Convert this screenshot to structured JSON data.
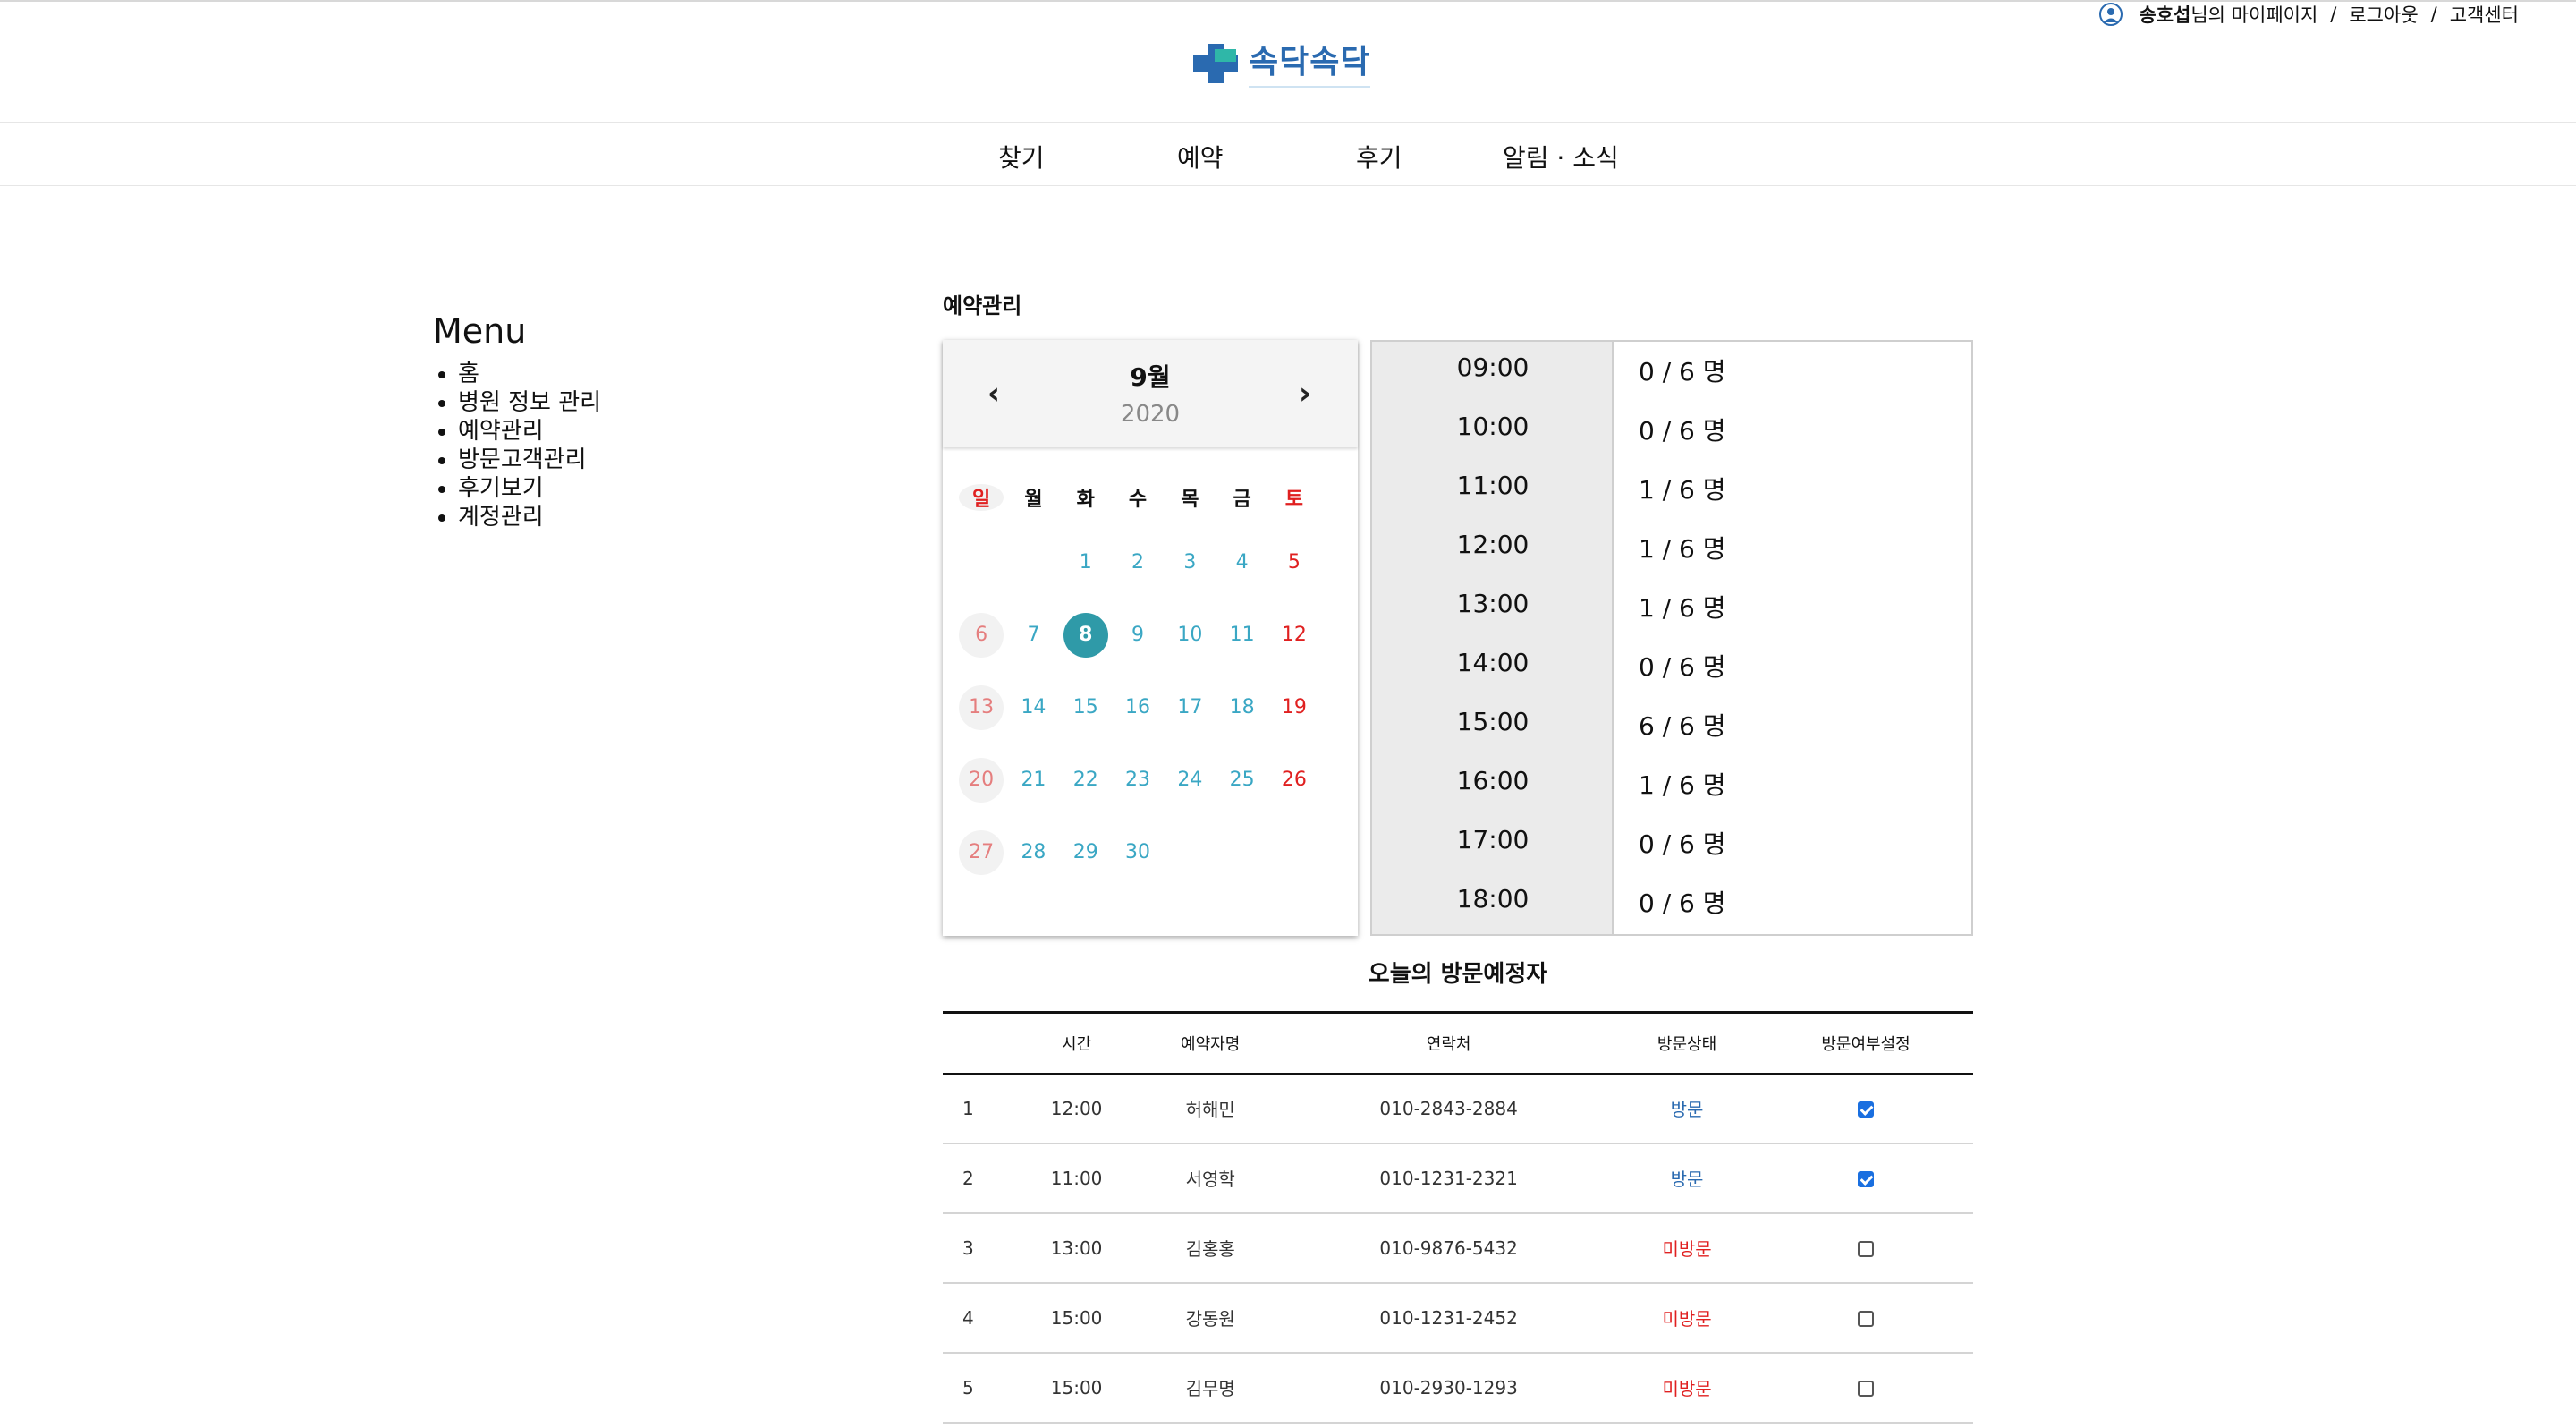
{
  "user_bar": {
    "user_name": "송호섭",
    "mypage_suffix": "님의 마이페이지",
    "sep1": "/",
    "logout": "로그아웃",
    "sep2": "/",
    "support": "고객센터"
  },
  "logo": {
    "text": "속닥속닥"
  },
  "nav": {
    "items": [
      "찾기",
      "예약",
      "후기",
      "알림 · 소식"
    ]
  },
  "sidebar": {
    "title": "Menu",
    "items": [
      "홈",
      "병원 정보 관리",
      "예약관리",
      "방문고객관리",
      "후기보기",
      "계정관리"
    ]
  },
  "main": {
    "title": "예약관리"
  },
  "calendar": {
    "month": "9월",
    "year": "2020",
    "prev_icon": "‹",
    "next_icon": "›",
    "weekdays": [
      "일",
      "월",
      "화",
      "수",
      "목",
      "금",
      "토"
    ],
    "weeks": [
      [
        "",
        "",
        "1",
        "2",
        "3",
        "4",
        "5"
      ],
      [
        "6",
        "7",
        "8",
        "9",
        "10",
        "11",
        "12"
      ],
      [
        "13",
        "14",
        "15",
        "16",
        "17",
        "18",
        "19"
      ],
      [
        "20",
        "21",
        "22",
        "23",
        "24",
        "25",
        "26"
      ],
      [
        "27",
        "28",
        "29",
        "30",
        "",
        "",
        ""
      ]
    ],
    "selected_day": "8"
  },
  "timeslots": [
    {
      "time": "09:00",
      "count": "0 / 6 명"
    },
    {
      "time": "10:00",
      "count": "0 / 6 명"
    },
    {
      "time": "11:00",
      "count": "1 / 6 명"
    },
    {
      "time": "12:00",
      "count": "1 / 6 명"
    },
    {
      "time": "13:00",
      "count": "1 / 6 명"
    },
    {
      "time": "14:00",
      "count": "0 / 6 명"
    },
    {
      "time": "15:00",
      "count": "6 / 6 명"
    },
    {
      "time": "16:00",
      "count": "1 / 6 명"
    },
    {
      "time": "17:00",
      "count": "0 / 6 명"
    },
    {
      "time": "18:00",
      "count": "0 / 6 명"
    }
  ],
  "visitors": {
    "title": "오늘의 방문예정자",
    "headers": [
      "",
      "시간",
      "예약자명",
      "연락처",
      "방문상태",
      "방문여부설정"
    ],
    "rows": [
      {
        "no": "1",
        "time": "12:00",
        "name": "허해민",
        "phone": "010-2843-2884",
        "status": "방문",
        "checked": true
      },
      {
        "no": "2",
        "time": "11:00",
        "name": "서영학",
        "phone": "010-1231-2321",
        "status": "방문",
        "checked": true
      },
      {
        "no": "3",
        "time": "13:00",
        "name": "김홍홍",
        "phone": "010-9876-5432",
        "status": "미방문",
        "checked": false
      },
      {
        "no": "4",
        "time": "15:00",
        "name": "강동원",
        "phone": "010-1231-2452",
        "status": "미방문",
        "checked": false
      },
      {
        "no": "5",
        "time": "15:00",
        "name": "김무명",
        "phone": "010-2930-1293",
        "status": "미방문",
        "checked": false
      }
    ]
  },
  "colors": {
    "brand": "#2a6ab0",
    "accent": "#2fb7a8",
    "selected_day": "#2f9aa8",
    "weekend": "#e02020",
    "visited": "#2a6ab0",
    "missed": "#e02020"
  }
}
